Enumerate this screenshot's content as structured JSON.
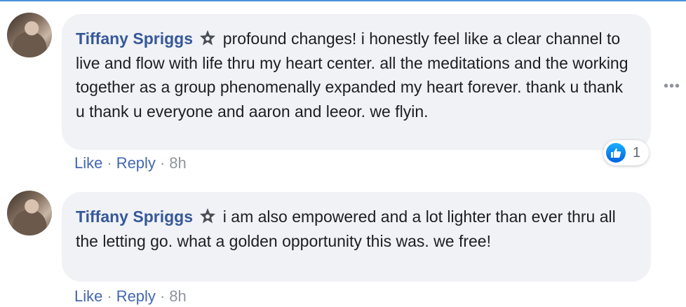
{
  "comments": [
    {
      "author": "Tiffany Spriggs",
      "text": "profound changes! i honestly feel like a clear channel to live and flow with life thru my heart center. all the meditations and the working together as a group phenomenally expanded my heart forever. thank u thank u thank u everyone and aaron and leeor. we flyin.",
      "like_label": "Like",
      "reply_label": "Reply",
      "time": "8h",
      "reaction_count": "1"
    },
    {
      "author": "Tiffany Spriggs",
      "text": "i am also empowered and a lot lighter than ever thru all the letting go. what a golden opportunity this was. we free!",
      "like_label": "Like",
      "reply_label": "Reply",
      "time": "8h"
    }
  ],
  "more_options": "•••",
  "separator": "·",
  "icons": {
    "badge": "top-fan-star-icon",
    "reaction": "like-thumb-icon"
  },
  "colors": {
    "author": "#365899",
    "link": "#4267b2",
    "bubble": "#f0f2f5"
  }
}
